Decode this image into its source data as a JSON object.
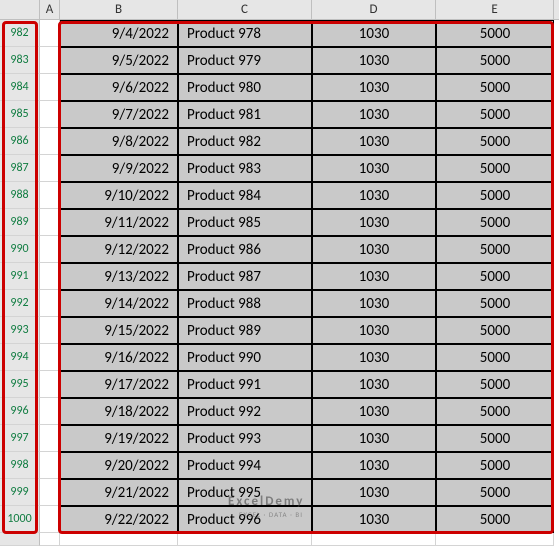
{
  "columns": [
    "A",
    "B",
    "C",
    "D",
    "E"
  ],
  "row_start": 982,
  "rows": [
    {
      "n": 982,
      "date": "9/4/2022",
      "prod": "Product 978",
      "v1": "1030",
      "v2": "5000"
    },
    {
      "n": 983,
      "date": "9/5/2022",
      "prod": "Product 979",
      "v1": "1030",
      "v2": "5000"
    },
    {
      "n": 984,
      "date": "9/6/2022",
      "prod": "Product 980",
      "v1": "1030",
      "v2": "5000"
    },
    {
      "n": 985,
      "date": "9/7/2022",
      "prod": "Product 981",
      "v1": "1030",
      "v2": "5000"
    },
    {
      "n": 986,
      "date": "9/8/2022",
      "prod": "Product 982",
      "v1": "1030",
      "v2": "5000"
    },
    {
      "n": 987,
      "date": "9/9/2022",
      "prod": "Product 983",
      "v1": "1030",
      "v2": "5000"
    },
    {
      "n": 988,
      "date": "9/10/2022",
      "prod": "Product 984",
      "v1": "1030",
      "v2": "5000"
    },
    {
      "n": 989,
      "date": "9/11/2022",
      "prod": "Product 985",
      "v1": "1030",
      "v2": "5000"
    },
    {
      "n": 990,
      "date": "9/12/2022",
      "prod": "Product 986",
      "v1": "1030",
      "v2": "5000"
    },
    {
      "n": 991,
      "date": "9/13/2022",
      "prod": "Product 987",
      "v1": "1030",
      "v2": "5000"
    },
    {
      "n": 992,
      "date": "9/14/2022",
      "prod": "Product 988",
      "v1": "1030",
      "v2": "5000"
    },
    {
      "n": 993,
      "date": "9/15/2022",
      "prod": "Product 989",
      "v1": "1030",
      "v2": "5000"
    },
    {
      "n": 994,
      "date": "9/16/2022",
      "prod": "Product 990",
      "v1": "1030",
      "v2": "5000"
    },
    {
      "n": 995,
      "date": "9/17/2022",
      "prod": "Product 991",
      "v1": "1030",
      "v2": "5000"
    },
    {
      "n": 996,
      "date": "9/18/2022",
      "prod": "Product 992",
      "v1": "1030",
      "v2": "5000"
    },
    {
      "n": 997,
      "date": "9/19/2022",
      "prod": "Product 993",
      "v1": "1030",
      "v2": "5000"
    },
    {
      "n": 998,
      "date": "9/20/2022",
      "prod": "Product 994",
      "v1": "1030",
      "v2": "5000"
    },
    {
      "n": 999,
      "date": "9/21/2022",
      "prod": "Product 995",
      "v1": "1030",
      "v2": "5000"
    },
    {
      "n": 1000,
      "date": "9/22/2022",
      "prod": "Product 996",
      "v1": "1030",
      "v2": "5000"
    }
  ],
  "blank_row_after": true,
  "watermark": {
    "main": "ExcelDemy",
    "sub": "EXCEL · DATA · BI"
  }
}
